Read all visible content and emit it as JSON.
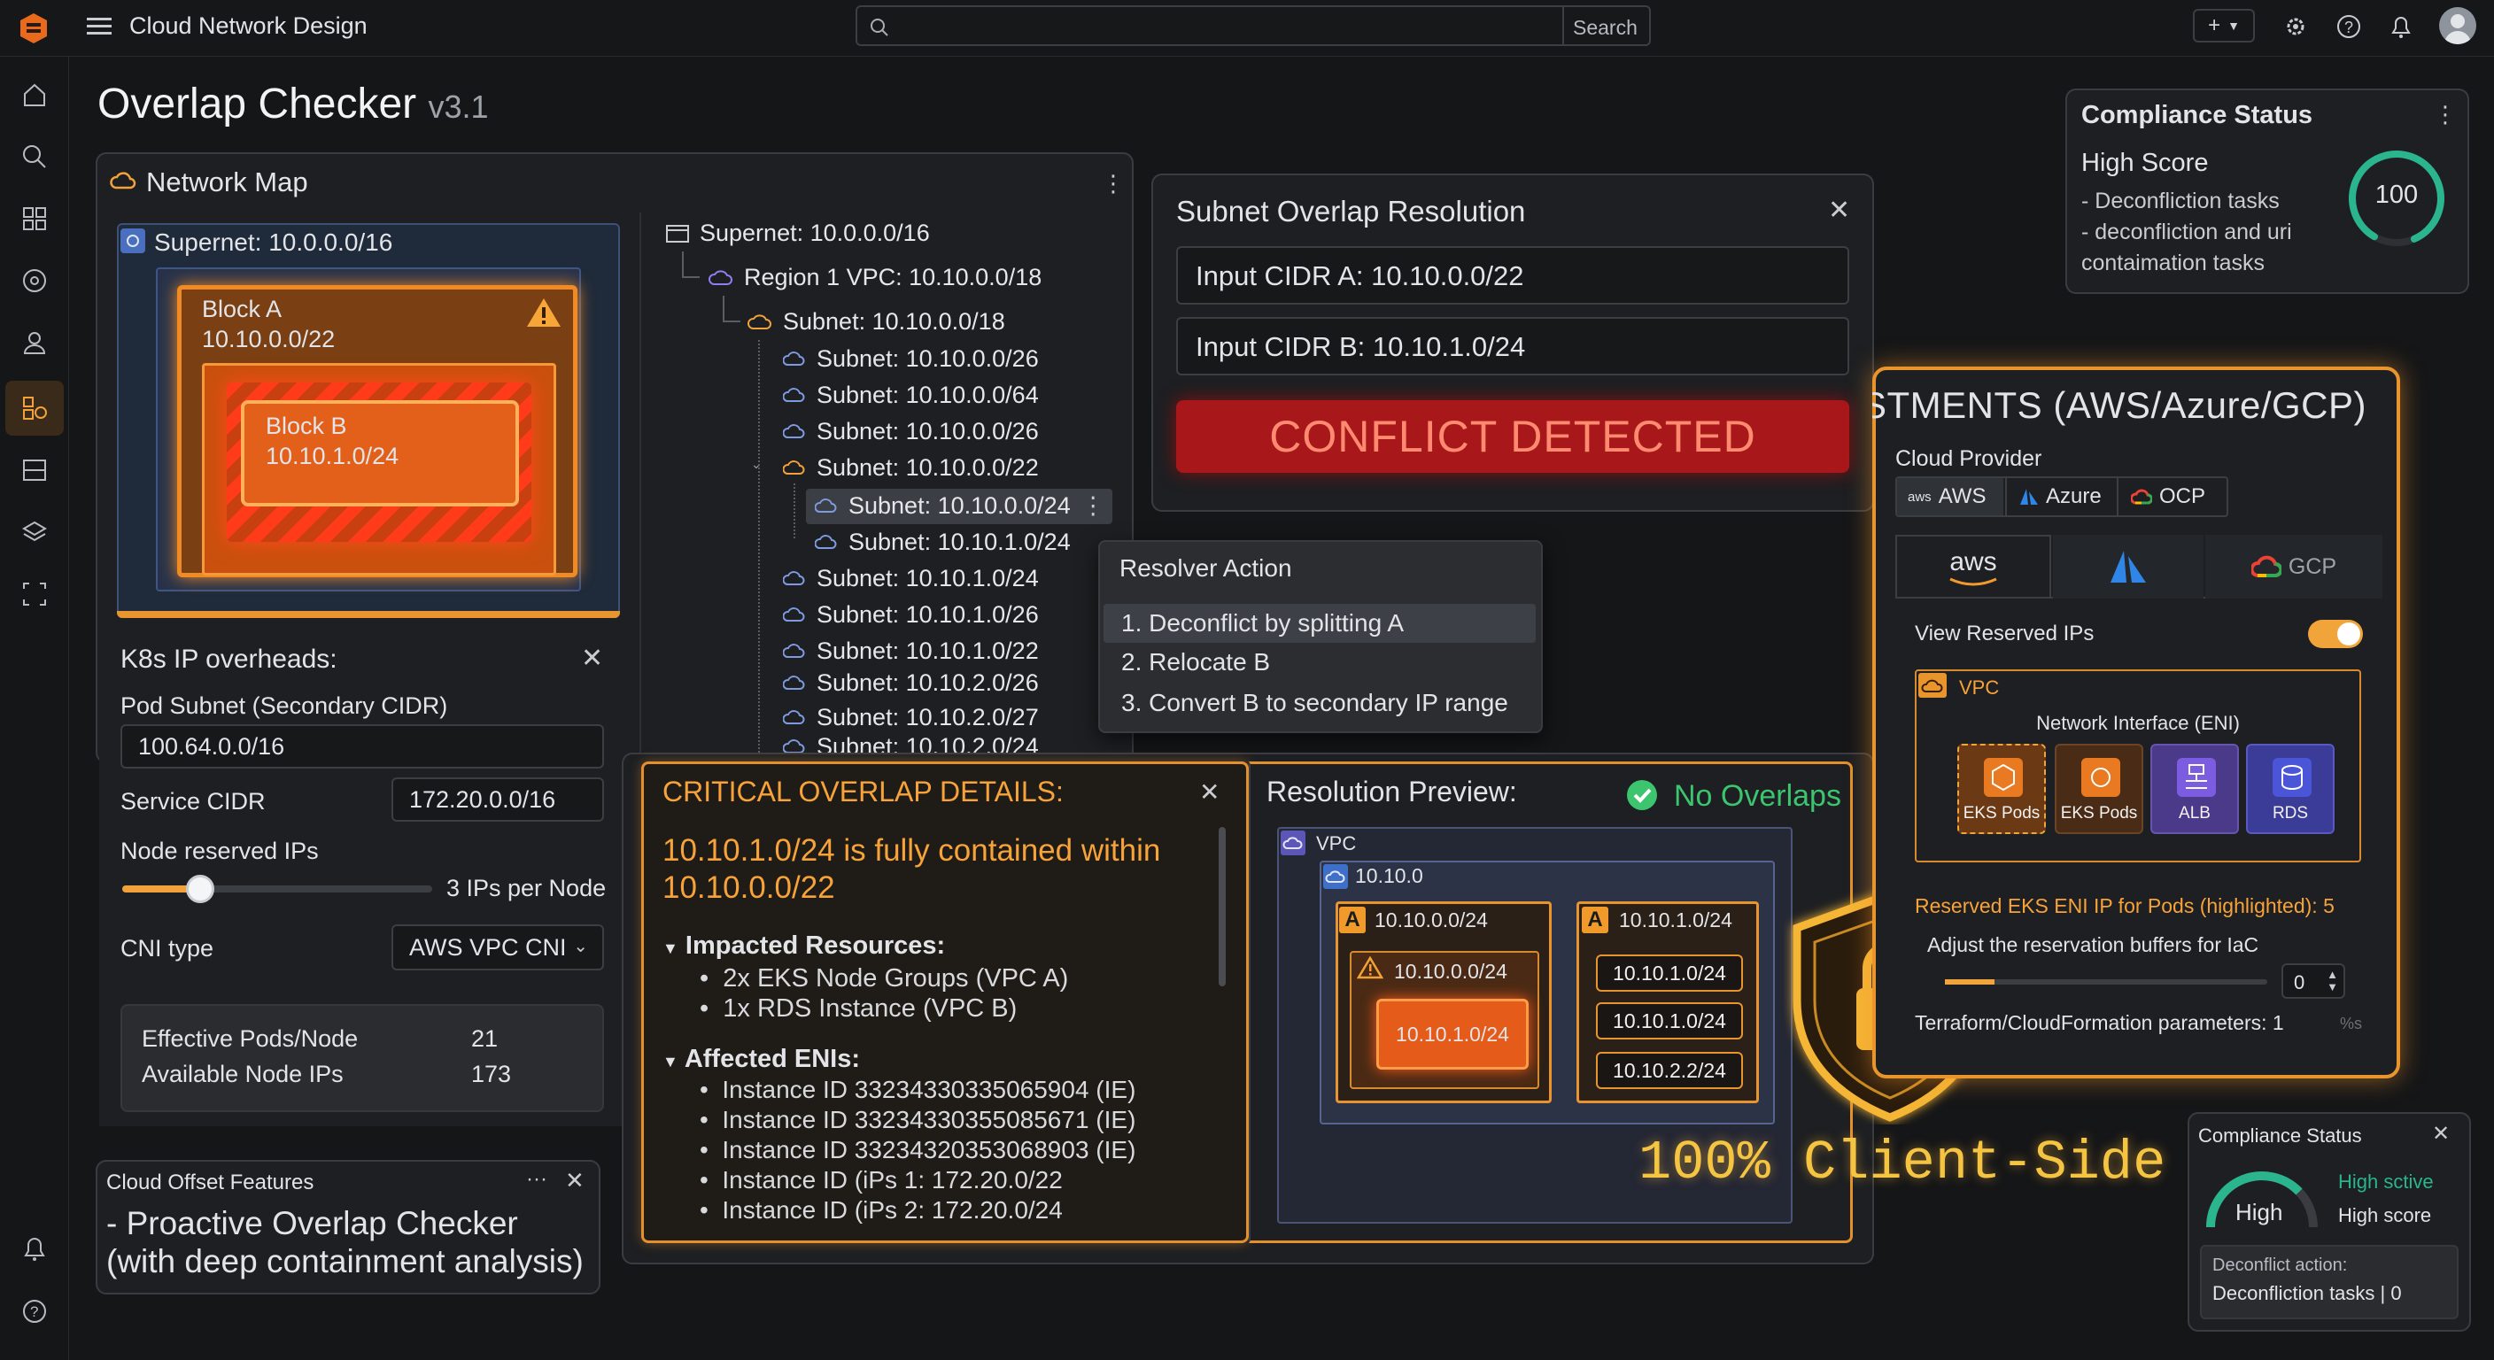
{
  "app": {
    "title": "Cloud Network Design",
    "search_placeholder": "Search"
  },
  "page": {
    "title": "Overlap Checker",
    "version": "v3.1"
  },
  "network_map": {
    "title": "Network Map",
    "supernet_label": "Supernet: 10.0.0.0/16",
    "block_a": {
      "name": "Block A",
      "cidr": "10.10.0.0/22"
    },
    "block_b": {
      "name": "Block B",
      "cidr": "10.10.1.0/24"
    }
  },
  "tree": {
    "root": "Supernet: 10.0.0.0/16",
    "region": "Region 1 VPC: 10.10.0.0/18",
    "subnet_parent": "Subnet: 10.10.0.0/18",
    "items": [
      {
        "label": "Subnet: 10.10.0.0/26"
      },
      {
        "label": "Subnet: 10.10.0.0/64"
      },
      {
        "label": "Subnet: 10.10.0.0/26"
      },
      {
        "label": "Subnet: 10.10.0.0/22"
      },
      {
        "label": "Subnet: 10.10.0.0/24"
      },
      {
        "label": "Subnet: 10.10.1.0/24"
      },
      {
        "label": "Subnet: 10.10.1.0/24"
      },
      {
        "label": "Subnet: 10.10.1.0/26"
      },
      {
        "label": "Subnet: 10.10.1.0/22"
      },
      {
        "label": "Subnet: 10.10.2.0/26"
      },
      {
        "label": "Subnet: 10.10.2.0/27"
      },
      {
        "label": "Subnet: 10.10.2.0/24"
      }
    ]
  },
  "k8s": {
    "title": "K8s IP overheads:",
    "pod_subnet_label": "Pod Subnet (Secondary CIDR)",
    "pod_subnet_value": "100.64.0.0/16",
    "service_cidr_label": "Service CIDR",
    "service_cidr_value": "172.20.0.0/16",
    "node_reserved_label": "Node reserved IPs",
    "node_reserved_value": "3 IPs per Node",
    "node_reserved_slider": 0.25,
    "cni_label": "CNI type",
    "cni_value": "AWS VPC CNI",
    "effective_pods_label": "Effective Pods/Node",
    "effective_pods_value": "21",
    "available_ips_label": "Available Node IPs",
    "available_ips_value": "173"
  },
  "offset": {
    "title": "Cloud Offset Features",
    "more": "···",
    "text": "- Proactive Overlap Checker (with deep containment analysis)"
  },
  "resolution": {
    "title": "Subnet Overlap Resolution",
    "input_a": "Input CIDR A: 10.10.0.0/22",
    "input_b": "Input CIDR B: 10.10.1.0/24",
    "conflict": "CONFLICT DETECTED"
  },
  "resolver": {
    "title": "Resolver Action",
    "options": [
      "1. Deconflict by splitting A",
      "2. Relocate B",
      "3. Convert B to secondary IP range"
    ]
  },
  "critical": {
    "title": "CRITICAL OVERLAP DETAILS:",
    "summary": "10.10.1.0/24 is fully contained within 10.10.0.0/22",
    "impacted_title": "Impacted Resources:",
    "impacted": [
      "2x EKS Node Groups (VPC A)",
      "1x RDS Instance (VPC B)"
    ],
    "enis_title": "Affected ENIs:",
    "enis": [
      "Instance ID 33234330335065904 (IE)",
      "Instance ID 33234330355085671 (IE)",
      "Instance ID 33234320353068903 (IE)",
      "Instance ID (iPs 1: 172.20.0/22",
      "Instance ID (iPs 2: 172.20.0/24"
    ]
  },
  "preview": {
    "title": "Resolution Preview:",
    "status": "No Overlaps",
    "vpc_label": "VPC",
    "inner_label": "10.10.0",
    "left_header": "10.10.0.0/24",
    "left_sub": "10.10.0.0/24",
    "left_inner": "10.10.1.0/24",
    "right_header": "10.10.1.0/24",
    "right_items": [
      "10.10.1.0/24",
      "10.10.1.0/24",
      "10.10.2.2/24"
    ],
    "badge": "A"
  },
  "client_side": "100% Client-Side",
  "compliance_top": {
    "title": "Compliance Status",
    "score_label": "High Score",
    "lines": [
      "- Deconfliction tasks",
      "- deconfliction and uri",
      "contaimation tasks"
    ],
    "score": "100",
    "fraction": 0.85
  },
  "adjustments": {
    "title": "JUSTMENTS (AWS/Azure/GCP)",
    "provider_label": "Cloud Provider",
    "providers": [
      "AWS",
      "Azure",
      "OCP"
    ],
    "aws_small": "aws",
    "tabs": [
      "aws",
      "",
      "GCP"
    ],
    "view_reserved": "View Reserved IPs",
    "vpc_label": "VPC",
    "eni_title": "Network Interface (ENI)",
    "enis": [
      "EKS Pods",
      "EKS Pods",
      "ALB",
      "RDS"
    ],
    "reserved_text": "Reserved EKS ENI IP for Pods (highlighted): 5",
    "adjust_text": "Adjust the reservation buffers for IaC",
    "buffer_value": "0",
    "terraform_text": "Terraform/CloudFormation parameters: 1",
    "unit": "%s"
  },
  "compliance_bottom": {
    "title": "Compliance Status",
    "gauge_label": "High",
    "right_line1": "High sctive",
    "right_line2": "High score",
    "action_label": "Deconflict action:",
    "action_value": "Deconfliction tasks | 0"
  },
  "colors": {
    "accent": "#f7a33a",
    "conflict": "#b3191a",
    "success": "#3cc46e",
    "teal": "#2bb58f"
  }
}
